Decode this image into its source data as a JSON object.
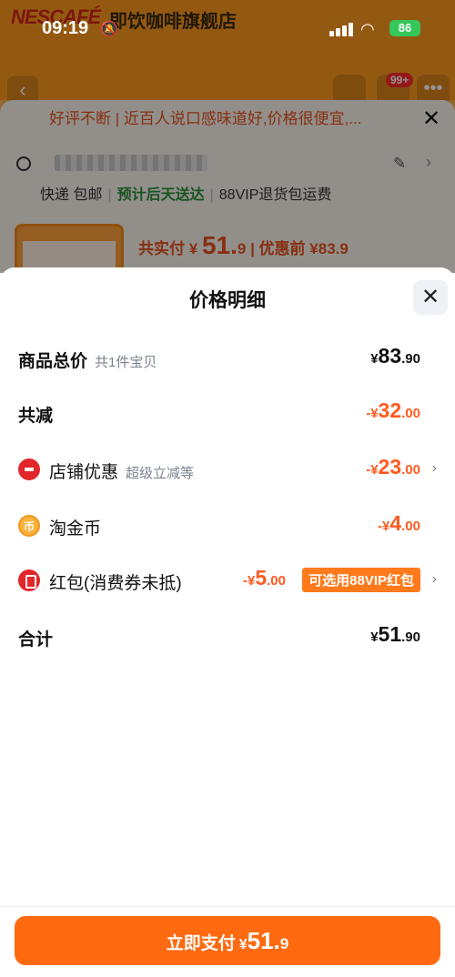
{
  "status_bar": {
    "time": "09:19",
    "battery": "86"
  },
  "background": {
    "brand": "NESCAFÉ",
    "shop_name": "即饮咖啡旗舰店",
    "badge": "99+",
    "banner": "好评不断 | 近百人说口感味道好,价格很便宜,...",
    "shipping": {
      "express": "快递 包邮",
      "eta": "预计后天送达",
      "returns": "88VIP退货包运费"
    },
    "total_paid_label": "共实付",
    "total_paid_currency": "¥",
    "total_paid_value": "51.",
    "total_paid_dec": "9",
    "before_discount": "| 优惠前 ¥83.9"
  },
  "sheet": {
    "title": "价格明细",
    "rows": [
      {
        "label": "商品总价",
        "sub": "共1件宝贝",
        "currency": "¥",
        "int": "83",
        "dec": ".90"
      },
      {
        "label": "共减",
        "currency": "-¥",
        "int": "32",
        "dec": ".00"
      },
      {
        "label": "店铺优惠",
        "sub": "超级立减等",
        "currency": "-¥",
        "int": "23",
        "dec": ".00"
      },
      {
        "label": "淘金币",
        "currency": "-¥",
        "int": "4",
        "dec": ".00"
      },
      {
        "label": "红包(消费券未抵)",
        "currency": "-¥",
        "int": "5",
        "dec": ".00",
        "tag": "可选用88VIP红包"
      },
      {
        "label": "合计",
        "currency": "¥",
        "int": "51",
        "dec": ".90"
      }
    ]
  },
  "footer": {
    "pay_label": "立即支付",
    "currency": "¥",
    "int": "51.",
    "dec": "9"
  },
  "colors": {
    "accent": "#ff6a10",
    "discount": "#ff5a1f"
  }
}
